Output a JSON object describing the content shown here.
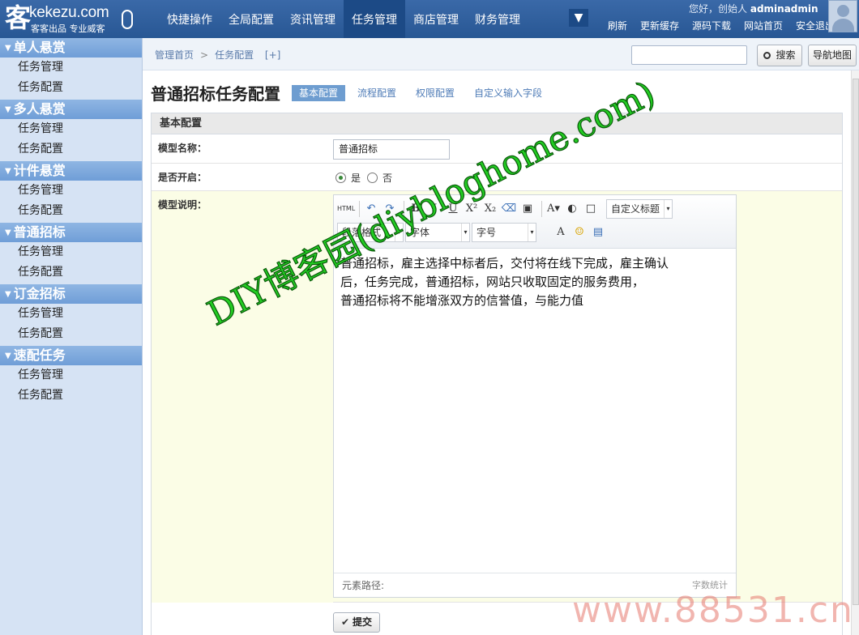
{
  "logo": {
    "mark": "客",
    "url": "kekezu.com",
    "slogan": "客客出品 专业威客"
  },
  "mainnav": [
    "快捷操作",
    "全局配置",
    "资讯管理",
    "任务管理",
    "商店管理",
    "财务管理"
  ],
  "mainnav_active_index": 3,
  "nav_toggle_glyph": "▼",
  "user": {
    "greeting": "您好，创始人",
    "name": "adminadmin"
  },
  "toplinks": [
    "刷新",
    "更新缓存",
    "源码下载",
    "网站首页",
    "安全退出"
  ],
  "sidebar": [
    {
      "title": "单人悬赏",
      "items": [
        "任务管理",
        "任务配置"
      ]
    },
    {
      "title": "多人悬赏",
      "items": [
        "任务管理",
        "任务配置"
      ]
    },
    {
      "title": "计件悬赏",
      "items": [
        "任务管理",
        "任务配置"
      ]
    },
    {
      "title": "普通招标",
      "items": [
        "任务管理",
        "任务配置"
      ]
    },
    {
      "title": "订金招标",
      "items": [
        "任务管理",
        "任务配置"
      ]
    },
    {
      "title": "速配任务",
      "items": [
        "任务管理",
        "任务配置"
      ]
    }
  ],
  "breadcrumb": {
    "home": "管理首页",
    "sep": ">",
    "current": "任务配置",
    "add": "[+]"
  },
  "search": {
    "value": "",
    "button_label": "搜索"
  },
  "navmap_label": "导航地图",
  "page_title": "普通招标任务配置",
  "subtabs": [
    "基本配置",
    "流程配置",
    "权限配置",
    "自定义输入字段"
  ],
  "subtab_active_index": 0,
  "form": {
    "section_title": "基本配置",
    "name_label": "模型名称：",
    "name_value": "普通招标",
    "enabled_label": "是否开启：",
    "enabled_yes": "是",
    "enabled_no": "否",
    "enabled_value": "是",
    "desc_label": "模型说明：",
    "submit_label": "提交"
  },
  "editor": {
    "html_btn": "HTML",
    "paragraph_select": "段落格式",
    "font_select": "字体",
    "size_select": "字号",
    "custom_title_select": "自定义标题",
    "content": [
      "普通招标，雇主选择中标者后，交付将在线下完成，雇主确认",
      "后，任务完成，普通招标，网站只收取固定的服务费用，",
      "普通招标将不能增涨双方的信誉值，与能力值"
    ],
    "path_label": "元素路径:",
    "count_label": "字数统计"
  },
  "watermarks": {
    "diagonal": "DIY博客园(diybloghome.com)",
    "corner": "www.88531.cn"
  }
}
